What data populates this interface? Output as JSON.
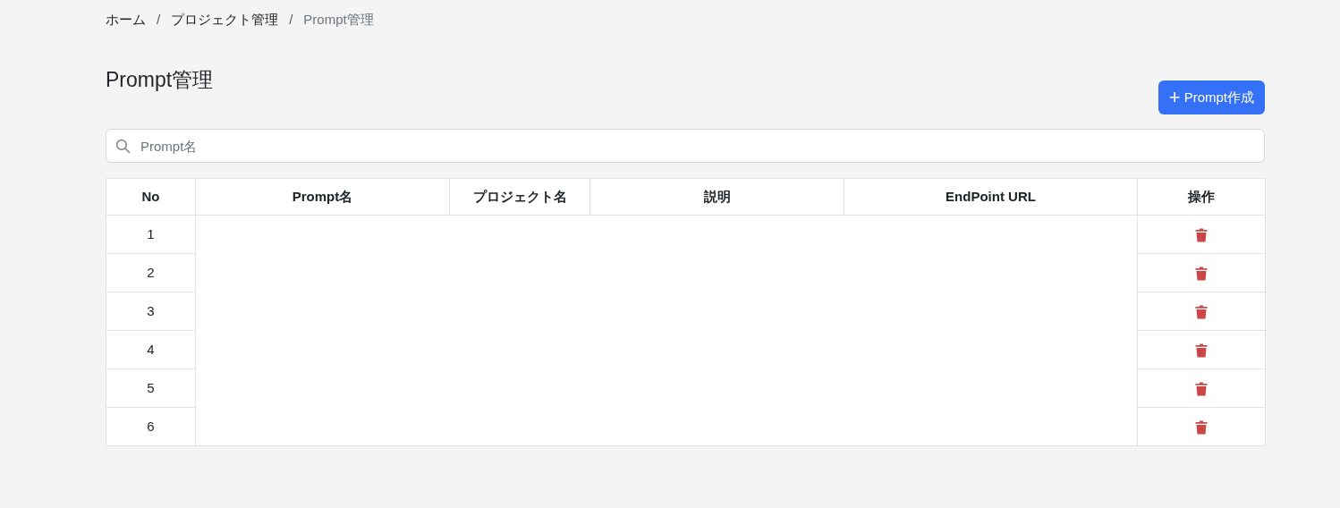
{
  "breadcrumb": [
    {
      "label": "ホーム",
      "current": false
    },
    {
      "label": "プロジェクト管理",
      "current": false
    },
    {
      "label": "Prompt管理",
      "current": true
    }
  ],
  "breadcrumb_separator": "/",
  "page_title": "Prompt管理",
  "create_button": {
    "icon": "+",
    "label": "Prompt作成"
  },
  "search": {
    "placeholder": "Prompt名"
  },
  "table": {
    "columns": [
      "No",
      "Prompt名",
      "プロジェクト名",
      "説明",
      "EndPoint URL",
      "操作"
    ],
    "rows": [
      {
        "no": "1"
      },
      {
        "no": "2"
      },
      {
        "no": "3"
      },
      {
        "no": "4"
      },
      {
        "no": "5"
      },
      {
        "no": "6"
      }
    ]
  }
}
